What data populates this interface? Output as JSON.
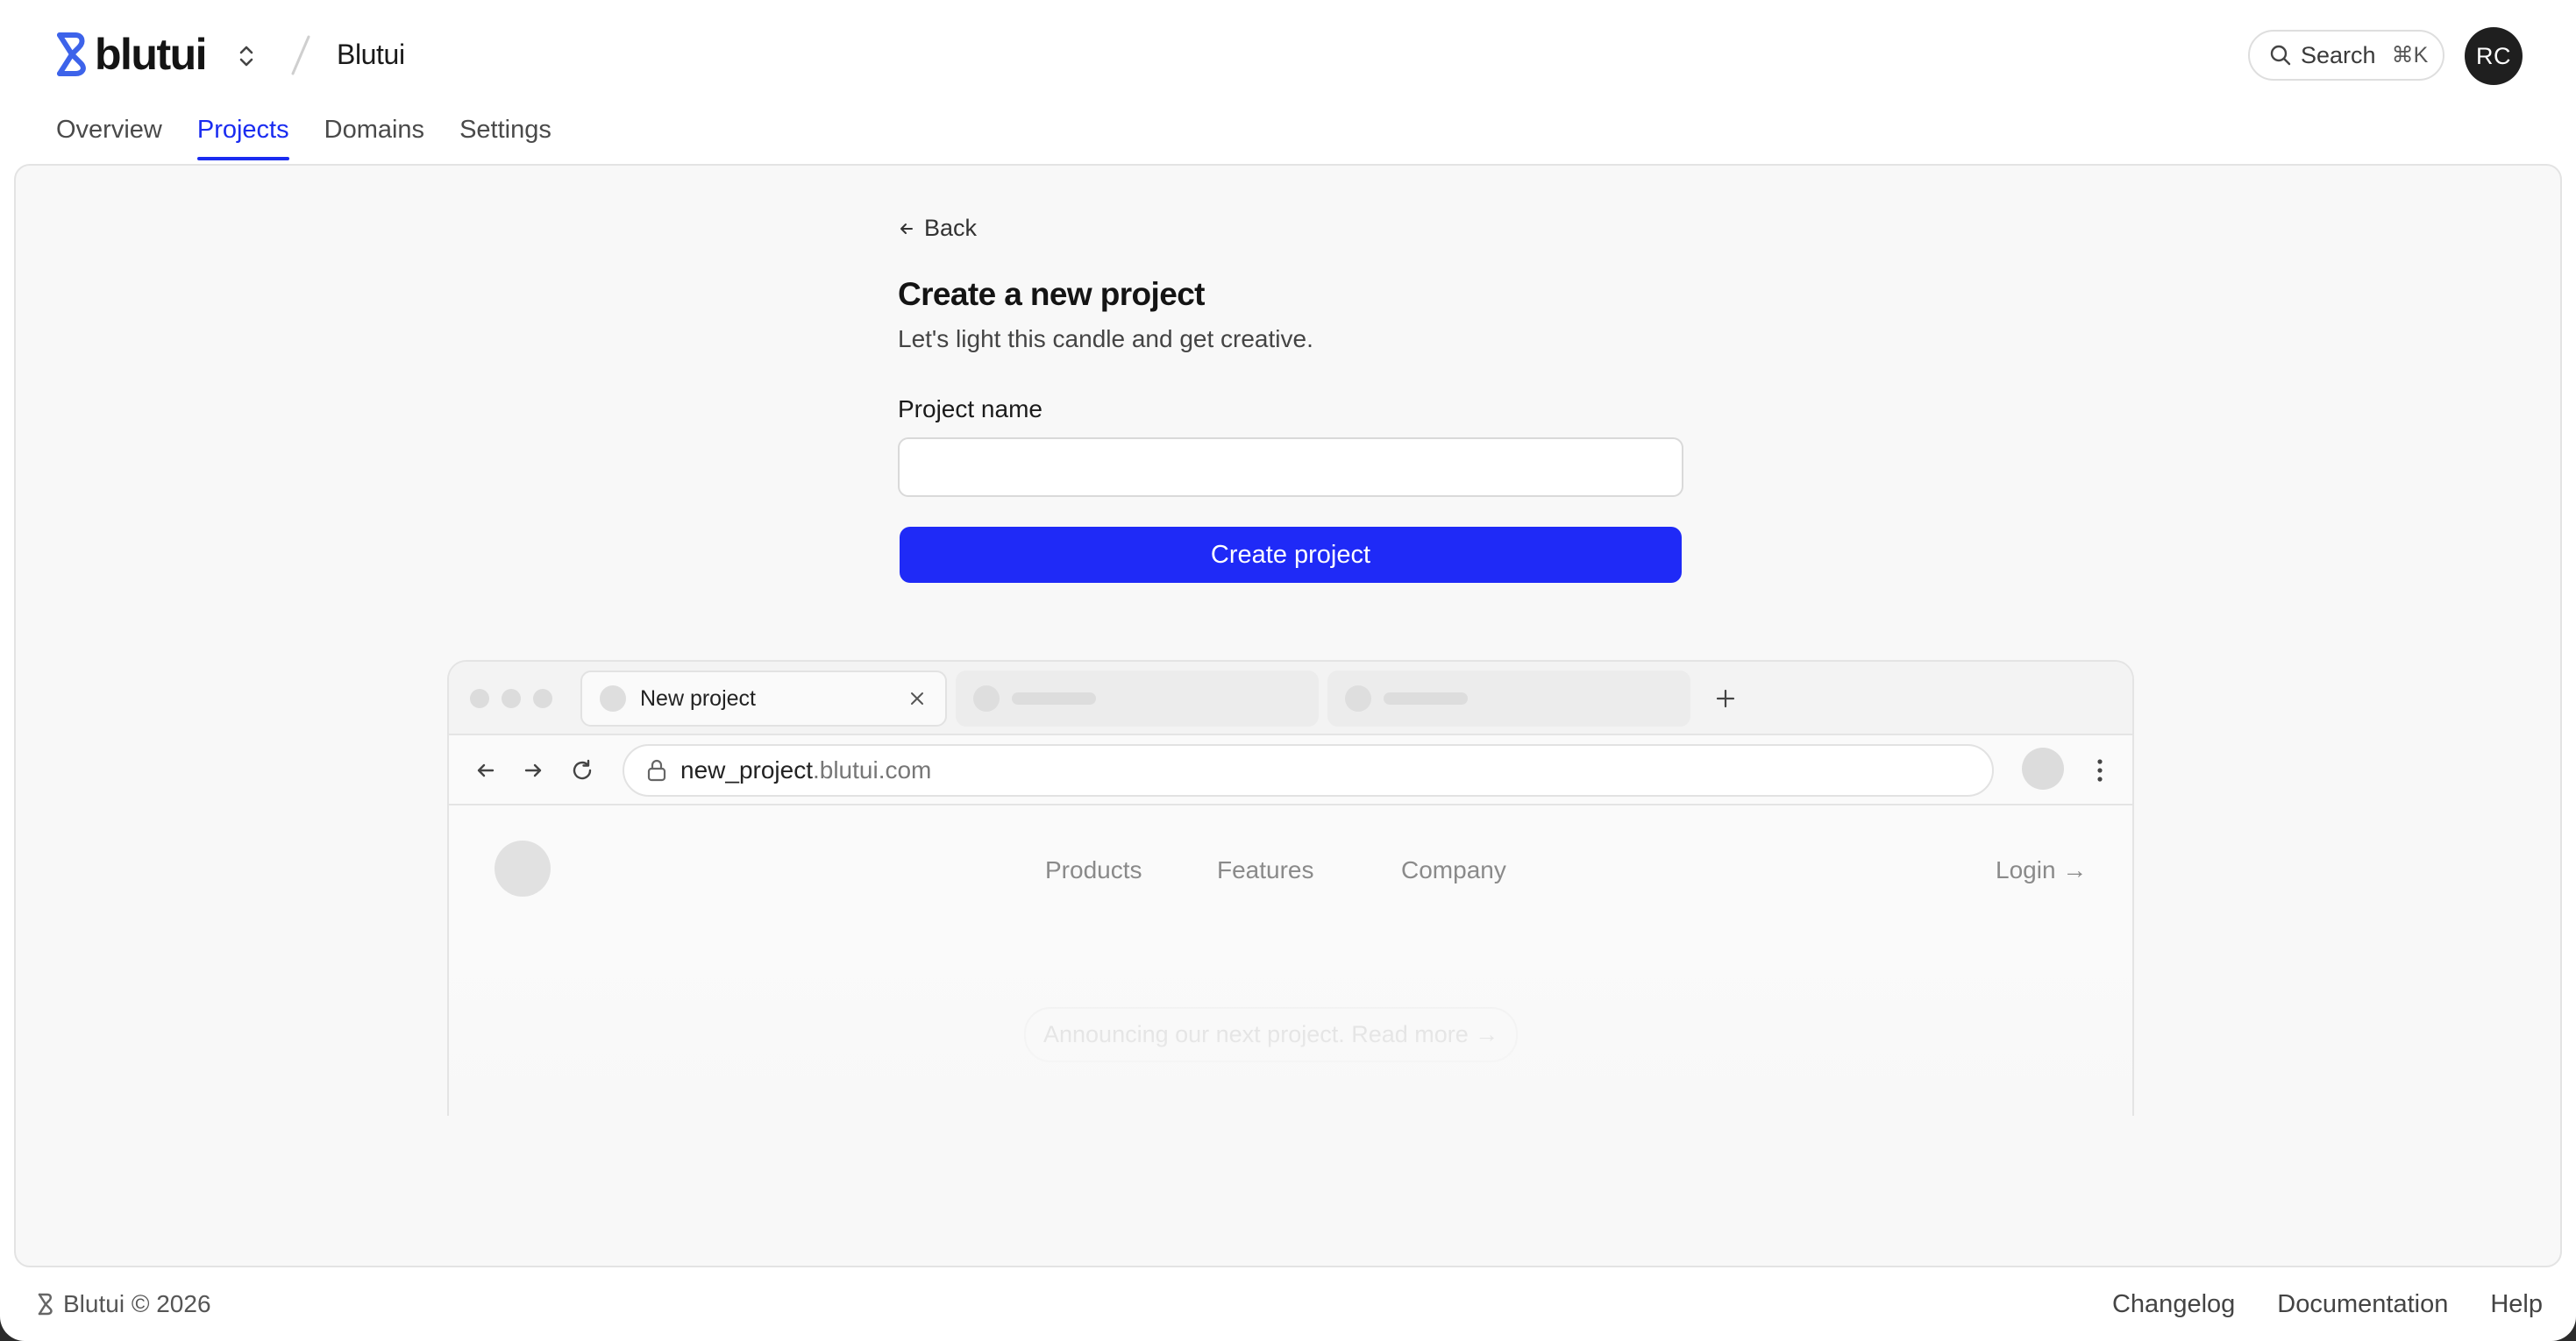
{
  "header": {
    "logo_text": "blutui",
    "team_name": "Blutui",
    "search_label": "Search",
    "search_shortcut": "⌘K",
    "avatar_initials": "RC"
  },
  "tabs": [
    {
      "label": "Overview",
      "active": false
    },
    {
      "label": "Projects",
      "active": true
    },
    {
      "label": "Domains",
      "active": false
    },
    {
      "label": "Settings",
      "active": false
    }
  ],
  "form": {
    "back_label": "Back",
    "title": "Create a new project",
    "subtitle": "Let's light this candle and get creative.",
    "project_name_label": "Project name",
    "project_name_value": "",
    "submit_label": "Create project"
  },
  "preview": {
    "tab_title": "New project",
    "url_host_strong": "new_project",
    "url_host_light": ".blutui.com",
    "site_nav": [
      "Products",
      "Features",
      "Company"
    ],
    "login_label": "Login →",
    "announcement": "Announcing our next project. Read more →"
  },
  "footer": {
    "brand": "Blutui © 2026",
    "links": [
      "Changelog",
      "Documentation",
      "Help"
    ]
  },
  "colors": {
    "accent": "#1f2af7",
    "tab_active": "#1a2cf0",
    "logo_blue": "#3d63ea"
  },
  "icons": [
    "blutui-logo-icon",
    "chevron-up-down-icon",
    "search-icon",
    "arrow-left-icon",
    "close-icon",
    "plus-icon",
    "back-icon",
    "forward-icon",
    "reload-icon",
    "lock-icon",
    "more-vertical-icon"
  ]
}
